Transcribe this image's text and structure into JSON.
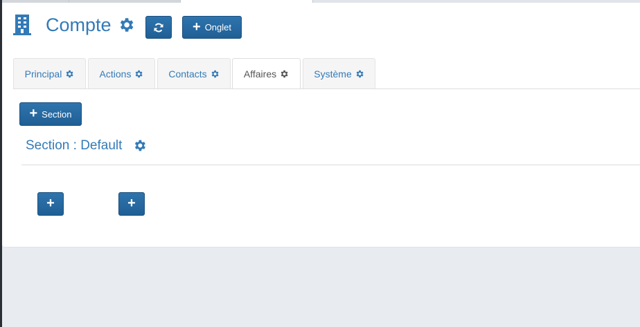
{
  "header": {
    "title": "Compte",
    "title_icon": "building-icon",
    "settings_icon": "gear-icon",
    "refresh_icon": "refresh-icon",
    "add_tab_label": "Onglet"
  },
  "tabs": [
    {
      "label": "Principal",
      "icon": "gear-icon",
      "active": false
    },
    {
      "label": "Actions",
      "icon": "gear-icon",
      "active": false
    },
    {
      "label": "Contacts",
      "icon": "gear-icon",
      "active": false
    },
    {
      "label": "Affaires",
      "icon": "gear-icon",
      "active": true
    },
    {
      "label": "Système",
      "icon": "gear-icon",
      "active": false
    }
  ],
  "content": {
    "add_section_label": "Section",
    "section_title": "Section : Default",
    "add_buttons": [
      "plus-icon",
      "plus-icon"
    ]
  },
  "colors": {
    "accent": "#337ab7",
    "button": "#23679e",
    "background": "#e8ecf1",
    "panel": "#ffffff"
  }
}
